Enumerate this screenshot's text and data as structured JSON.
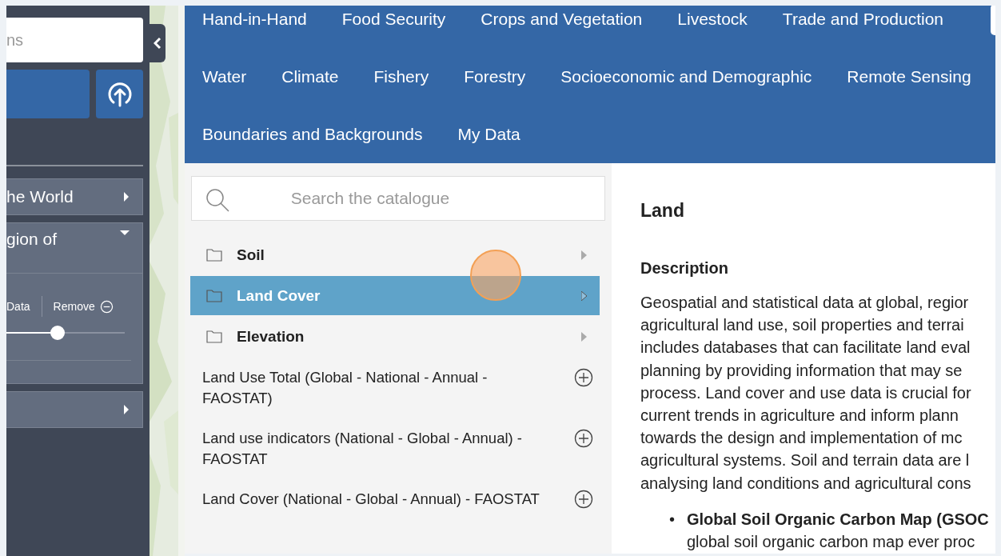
{
  "sidebar": {
    "search": {
      "placeholder": "ns"
    },
    "layers": [
      {
        "title": "he World",
        "expanded": false
      },
      {
        "title": "gion of",
        "expanded": true,
        "actions": [
          "Data",
          "Remove"
        ],
        "opacity": {
          "level": 0.43
        }
      },
      {
        "expanded": false
      }
    ]
  },
  "nav": {
    "items": [
      "Hand-in-Hand",
      "Food Security",
      "Crops and Vegetation",
      "Livestock",
      "Trade and Production",
      "Water",
      "Climate",
      "Fishery",
      "Forestry",
      "Socioeconomic and Demographic",
      "Remote Sensing",
      "Boundaries and Backgrounds",
      "My Data"
    ]
  },
  "catalogue": {
    "search": {
      "placeholder": "Search the catalogue"
    },
    "items": [
      {
        "kind": "folder",
        "label": "Soil",
        "selected": false
      },
      {
        "kind": "folder",
        "label": "Land Cover",
        "selected": true
      },
      {
        "kind": "folder",
        "label": "Elevation",
        "selected": false
      },
      {
        "kind": "dataset",
        "label": "Land Use Total (Global - National - Annual - FAOSTAT)"
      },
      {
        "kind": "dataset",
        "label": "Land use indicators (National - Global - Annual) - FAOSTAT"
      },
      {
        "kind": "dataset",
        "label": "Land Cover (National - Global - Annual) - FAOSTAT"
      }
    ]
  },
  "pointer_highlight": true,
  "info": {
    "title": "Land",
    "heading": "Description",
    "paragraph": "Geospatial and statistical data at global, regior\nagricultural land use, soil properties and terrai\nincludes databases that can facilitate land eval\nplanning by providing information that may se\nprocess. Land cover and use data is crucial for\ncurrent trends in agriculture and inform plann\ntowards the design and implementation of mc\nagricultural systems. Soil and terrain data are l\nanalysing land conditions and agricultural cons",
    "bullets": [
      {
        "marker": "•",
        "text": "**Global Soil Organic Carbon Map (GSOC**\nglobal soil organic carbon map ever proc"
      }
    ]
  }
}
